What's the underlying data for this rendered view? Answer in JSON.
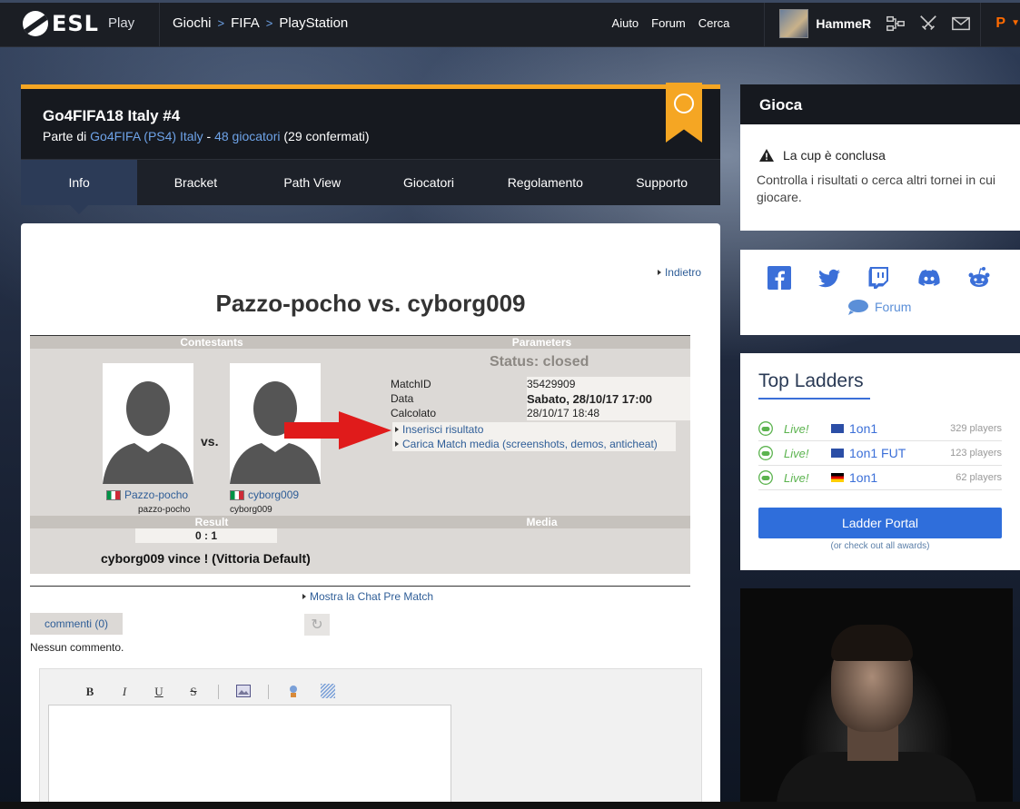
{
  "topnav": {
    "logo": "ESL",
    "logo_sub": "Play",
    "breadcrumbs": [
      "Giochi",
      "FIFA",
      "PlayStation"
    ],
    "links": [
      "Aiuto",
      "Forum",
      "Cerca"
    ],
    "username": "HammeR",
    "icons": [
      "bracket-icon",
      "swords-icon",
      "mail-icon",
      "playstation-icon"
    ]
  },
  "tournament": {
    "title": "Go4FIFA18 Italy #4",
    "sub_prefix": "Parte di",
    "sub_link": "Go4FIFA (PS4) Italy",
    "sub_dash": "-",
    "players_link": "48 giocatori",
    "confirmed": "(29 confermati)",
    "tabs": [
      "Info",
      "Bracket",
      "Path View",
      "Giocatori",
      "Regolamento",
      "Supporto"
    ],
    "active_tab": 0
  },
  "match": {
    "back": "Indietro",
    "title": "Pazzo-pocho vs. cyborg009",
    "contestants_header": "Contestants",
    "parameters_header": "Parameters",
    "status": "Status: closed",
    "player1": {
      "name": "Pazzo-pocho",
      "sub": "pazzo-pocho"
    },
    "player2": {
      "name": "cyborg009",
      "sub": "cyborg009"
    },
    "vs": "vs.",
    "params": [
      {
        "label": "MatchID",
        "value": "35429909"
      },
      {
        "label": "Data",
        "value": "Sabato, 28/10/17 17:00"
      },
      {
        "label": "Calcolato",
        "value": "28/10/17 18:48"
      }
    ],
    "links": [
      "Inserisci risultato",
      "Carica Match media (screenshots, demos, anticheat)"
    ],
    "result_header": "Result",
    "media_header": "Media",
    "score": "0 : 1",
    "winner": "cyborg009 vince ! (Vittoria Default)",
    "chat_link": "Mostra la Chat Pre Match",
    "comments_btn": "commenti (0)",
    "no_comments": "Nessun commento.",
    "toolbar": [
      "B",
      "I",
      "U",
      "S"
    ]
  },
  "sidebar": {
    "play_title": "Gioca",
    "cup_closed": "La cup è conclusa",
    "cup_text": "Controlla i risultati o cerca altri tornei in cui giocare.",
    "socials": [
      "facebook-icon",
      "twitter-icon",
      "twitch-icon",
      "discord-icon",
      "reddit-icon"
    ],
    "forum": "Forum",
    "ladders_title": "Top Ladders",
    "ladders": [
      {
        "status": "Live!",
        "flag": "eu",
        "name": "1on1",
        "count": "329 players"
      },
      {
        "status": "Live!",
        "flag": "eu",
        "name": "1on1 FUT",
        "count": "123 players"
      },
      {
        "status": "Live!",
        "flag": "de",
        "name": "1on1",
        "count": "62 players"
      }
    ],
    "ladder_portal": "Ladder Portal",
    "ladder_sub": "(or check out all awards)"
  }
}
